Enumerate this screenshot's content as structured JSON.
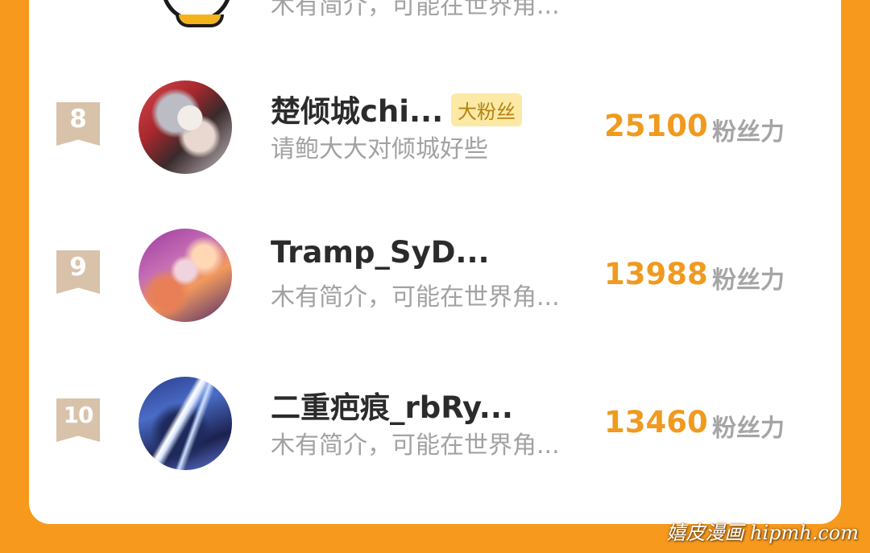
{
  "colors": {
    "frame": "#f7991d",
    "card": "#ffffff",
    "score": "#f09a1e",
    "rank_badge": "#d9c2aa",
    "badge_bg": "#fbe9a5"
  },
  "previous_entry": {
    "bio": "木有简介，可能在世界角..."
  },
  "entries": [
    {
      "rank": "8",
      "name": "楚倾城chi...",
      "badge": "大粉丝",
      "bio": "请鲍大大对倾城好些",
      "score": "25100",
      "score_unit": "粉丝力"
    },
    {
      "rank": "9",
      "name": "Tramp_SyD...",
      "bio": "木有简介，可能在世界角...",
      "score": "13988",
      "score_unit": "粉丝力"
    },
    {
      "rank": "10",
      "name": "二重疤痕_rbRy...",
      "bio": "木有简介，可能在世界角...",
      "score": "13460",
      "score_unit": "粉丝力"
    }
  ],
  "watermark": "嬉皮漫画 hipmh.com"
}
